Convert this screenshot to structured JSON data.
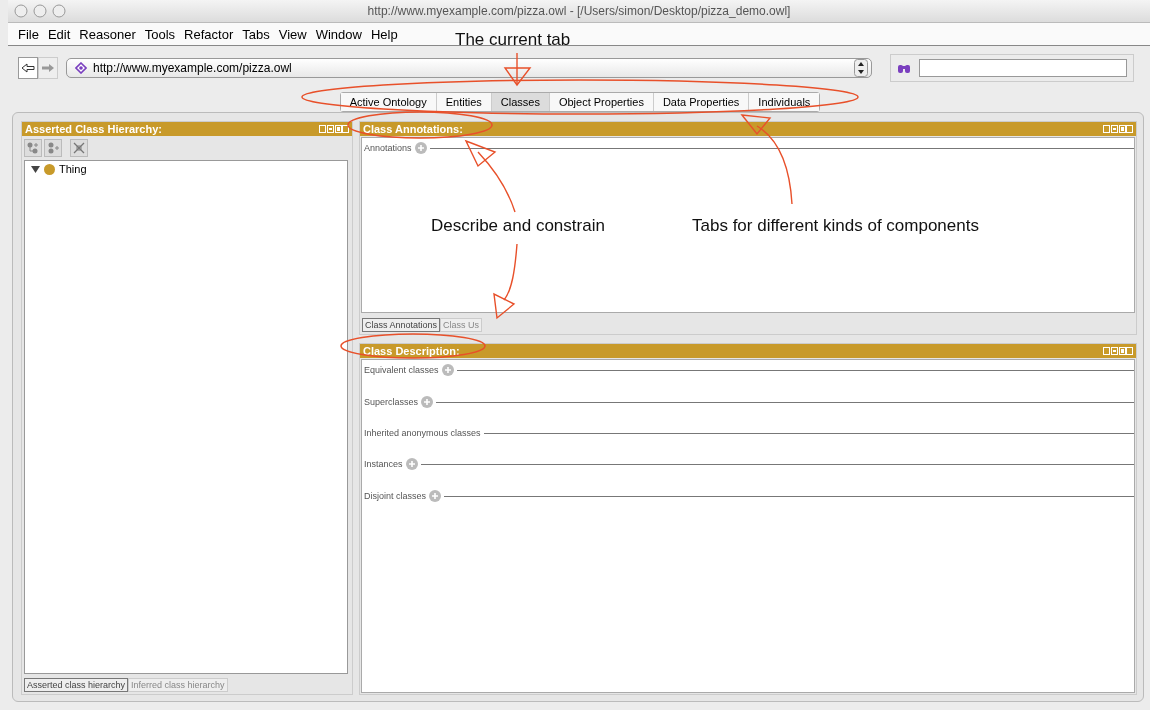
{
  "window": {
    "title": "http://www.myexample.com/pizza.owl - [/Users/simon/Desktop/pizza_demo.owl]"
  },
  "menu": [
    "File",
    "Edit",
    "Reasoner",
    "Tools",
    "Refactor",
    "Tabs",
    "View",
    "Window",
    "Help"
  ],
  "address": {
    "value": "http://www.myexample.com/pizza.owl"
  },
  "tabs": [
    {
      "label": "Active Ontology",
      "selected": false
    },
    {
      "label": "Entities",
      "selected": false
    },
    {
      "label": "Classes",
      "selected": true
    },
    {
      "label": "Object Properties",
      "selected": false
    },
    {
      "label": "Data Properties",
      "selected": false
    },
    {
      "label": "Individuals",
      "selected": false
    }
  ],
  "hierarchy_panel": {
    "title": "Asserted Class Hierarchy:",
    "tree": [
      {
        "label": "Thing",
        "expanded": true
      }
    ],
    "view_tabs": [
      {
        "label": "Asserted class hierarchy",
        "selected": true
      },
      {
        "label": "Inferred class hierarchy",
        "selected": false
      }
    ]
  },
  "annotations_panel": {
    "title": "Class Annotations:",
    "sections": [
      {
        "label": "Annotations",
        "addable": true
      }
    ],
    "view_tabs": [
      {
        "label": "Class Annotations",
        "selected": true
      },
      {
        "label": "Class Us",
        "selected": false
      }
    ]
  },
  "description_panel": {
    "title": "Class Description:",
    "sections": [
      {
        "label": "Equivalent classes",
        "addable": true
      },
      {
        "label": "Superclasses",
        "addable": true
      },
      {
        "label": "Inherited anonymous classes",
        "addable": false
      },
      {
        "label": "Instances",
        "addable": true
      },
      {
        "label": "Disjoint classes",
        "addable": true
      }
    ]
  },
  "callouts": [
    {
      "text": "The current tab"
    },
    {
      "text": "Describe and constrain"
    },
    {
      "text": "Tabs for different kinds of components"
    }
  ]
}
